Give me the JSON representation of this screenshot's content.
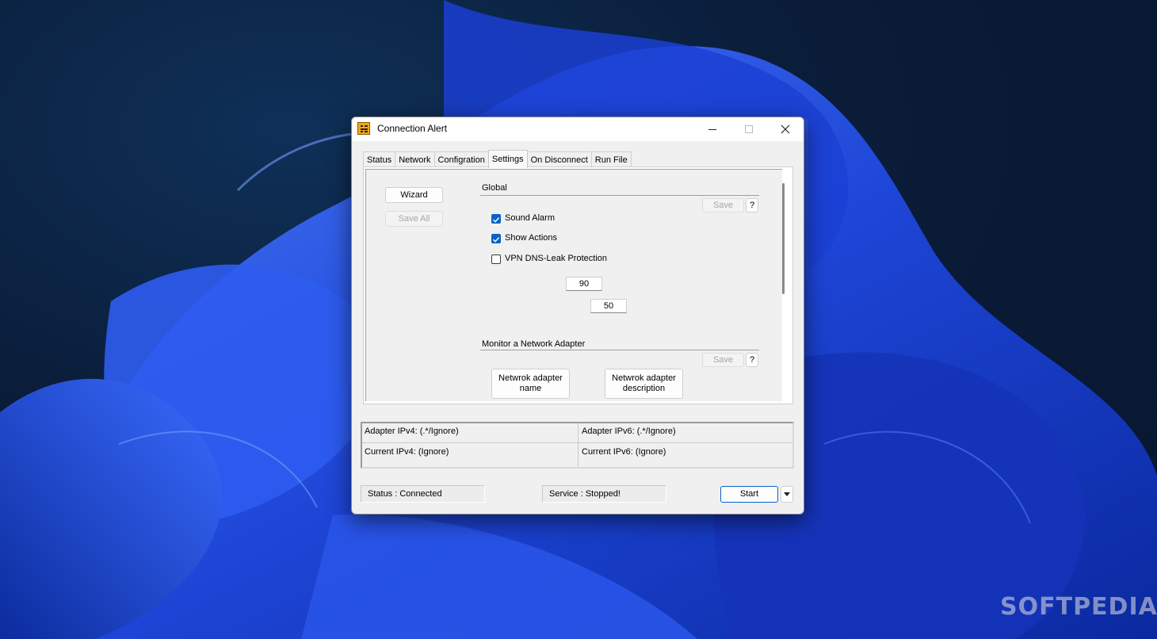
{
  "window": {
    "title": "Connection Alert"
  },
  "tabs": [
    {
      "label": "Status"
    },
    {
      "label": "Network"
    },
    {
      "label": "Configration"
    },
    {
      "label": "Settings",
      "active": true
    },
    {
      "label": "On Disconnect"
    },
    {
      "label": "Run File"
    }
  ],
  "settings": {
    "wizard_label": "Wizard",
    "save_all_label": "Save All",
    "global": {
      "title": "Global",
      "save_label": "Save",
      "help_label": "?",
      "options": [
        {
          "label": "Sound Alarm",
          "checked": true
        },
        {
          "label": "Show Actions",
          "checked": true
        },
        {
          "label": "VPN DNS-Leak Protection",
          "checked": false
        }
      ],
      "value_1": "90",
      "value_2": "50"
    },
    "monitor": {
      "title": "Monitor a Network Adapter",
      "save_label": "Save",
      "help_label": "?",
      "adapter_name_label": "Netwrok adapter name",
      "adapter_desc_label": "Netwrok adapter description"
    }
  },
  "ip_info": {
    "adapter_ipv4": "Adapter IPv4: (.*/Ignore)",
    "adapter_ipv6": "Adapter IPv6: (.*/Ignore)",
    "current_ipv4": "Current IPv4: (Ignore)",
    "current_ipv6": "Current IPv6: (Ignore)"
  },
  "footer": {
    "status": "Status : Connected",
    "service": "Service : Stopped!",
    "start_label": "Start"
  },
  "watermark": "SOFTPEDIA",
  "colors": {
    "accent": "#0a62c8",
    "wallpaper_dark": "#0a1c38",
    "bloom_blue": "#1f48e0"
  }
}
